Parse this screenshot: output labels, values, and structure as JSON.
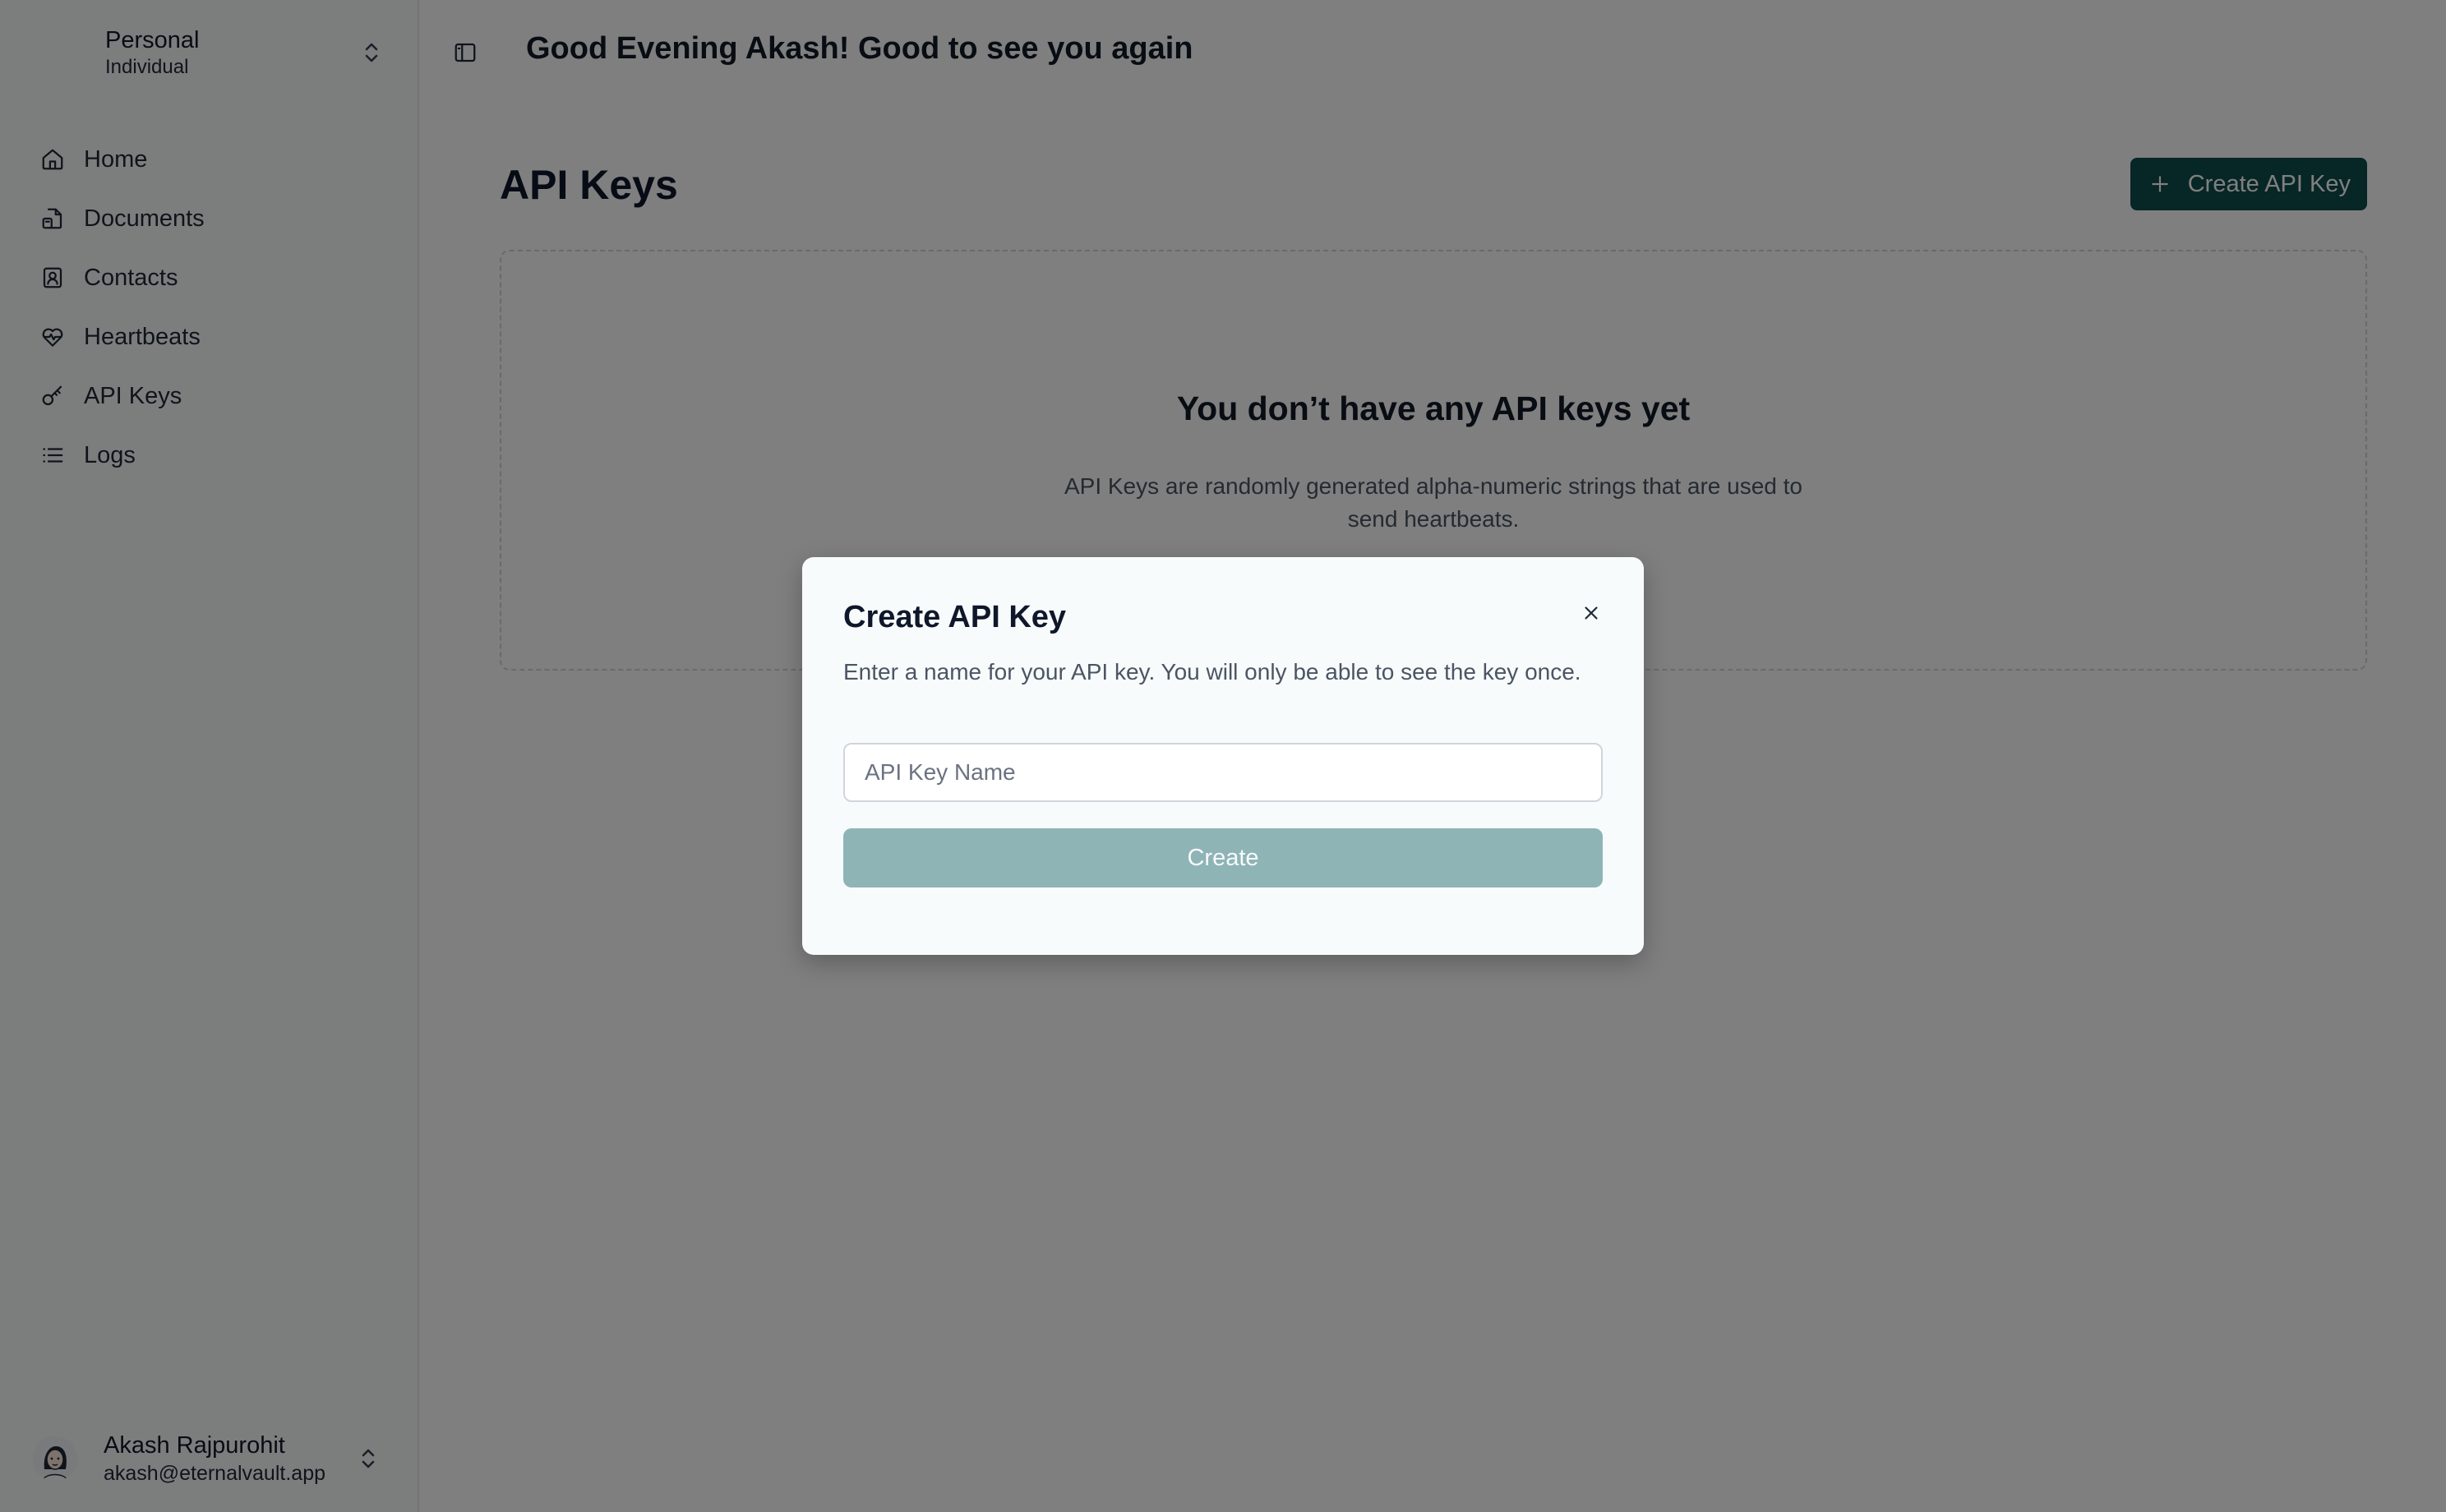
{
  "colors": {
    "accent": "#0f4c4c",
    "submit_disabled": "#8eb4b6",
    "overlay": "rgba(0,0,0,0.5)"
  },
  "sidebar": {
    "workspace": {
      "name": "Personal",
      "type": "Individual"
    },
    "items": [
      {
        "label": "Home",
        "icon": "home-icon"
      },
      {
        "label": "Documents",
        "icon": "documents-icon"
      },
      {
        "label": "Contacts",
        "icon": "contacts-icon"
      },
      {
        "label": "Heartbeats",
        "icon": "heartbeat-icon"
      },
      {
        "label": "API Keys",
        "icon": "key-icon"
      },
      {
        "label": "Logs",
        "icon": "list-icon"
      }
    ],
    "user": {
      "name": "Akash Rajpurohit",
      "email": "akash@eternalvault.app"
    }
  },
  "header": {
    "greeting": "Good Evening Akash! Good to see you again"
  },
  "main": {
    "title": "API Keys",
    "create_button_label": "Create API Key",
    "empty_state": {
      "title": "You don’t have any API keys yet",
      "description": "API Keys are randomly generated alpha-numeric strings that are used to send heartbeats."
    }
  },
  "dialog": {
    "title": "Create API Key",
    "description": "Enter a name for your API key. You will only be able to see the key once.",
    "input": {
      "placeholder": "API Key Name",
      "value": ""
    },
    "submit_label": "Create"
  }
}
